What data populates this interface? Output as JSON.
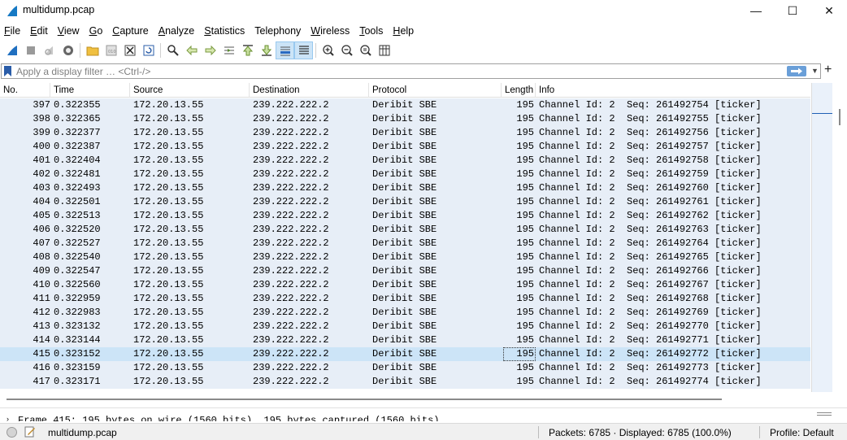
{
  "window": {
    "title": "multidump.pcap",
    "minimize": "—",
    "maximize": "☐",
    "close": "✕"
  },
  "menu": [
    {
      "label": "File",
      "u": "F",
      "rest": "ile"
    },
    {
      "label": "Edit",
      "u": "E",
      "rest": "dit"
    },
    {
      "label": "View",
      "u": "V",
      "rest": "iew"
    },
    {
      "label": "Go",
      "u": "G",
      "rest": "o"
    },
    {
      "label": "Capture",
      "u": "C",
      "rest": "apture"
    },
    {
      "label": "Analyze",
      "u": "A",
      "rest": "nalyze"
    },
    {
      "label": "Statistics",
      "u": "S",
      "rest": "tatistics"
    },
    {
      "label": "Telephony",
      "u": "",
      "rest": "Telephony"
    },
    {
      "label": "Wireless",
      "u": "W",
      "rest": "ireless"
    },
    {
      "label": "Tools",
      "u": "T",
      "rest": "ools"
    },
    {
      "label": "Help",
      "u": "H",
      "rest": "elp"
    }
  ],
  "toolbar": {
    "icons": [
      "shark-fin-start-icon",
      "stop-capture-icon",
      "restart-capture-icon",
      "capture-options-icon",
      "open-file-icon",
      "save-file-icon",
      "close-file-icon",
      "reload-file-icon",
      "find-packet-icon",
      "go-back-icon",
      "go-forward-icon",
      "go-to-packet-icon",
      "go-first-icon",
      "go-last-icon",
      "autoscroll-icon",
      "colorize-icon",
      "zoom-in-icon",
      "zoom-out-icon",
      "zoom-normal-icon",
      "resize-columns-icon"
    ],
    "active": [
      "autoscroll-icon"
    ]
  },
  "filter": {
    "placeholder": "Apply a display filter … <Ctrl-/>",
    "value": ""
  },
  "columns": [
    "No.",
    "Time",
    "Source",
    "Destination",
    "Protocol",
    "Length",
    "Info"
  ],
  "packets": [
    {
      "no": "397",
      "time": "0.322355",
      "src": "172.20.13.55",
      "dst": "239.222.222.2",
      "proto": "Deribit SBE",
      "len": "195",
      "info": "Channel Id: 2  Seq: 261492754 [ticker]"
    },
    {
      "no": "398",
      "time": "0.322365",
      "src": "172.20.13.55",
      "dst": "239.222.222.2",
      "proto": "Deribit SBE",
      "len": "195",
      "info": "Channel Id: 2  Seq: 261492755 [ticker]"
    },
    {
      "no": "399",
      "time": "0.322377",
      "src": "172.20.13.55",
      "dst": "239.222.222.2",
      "proto": "Deribit SBE",
      "len": "195",
      "info": "Channel Id: 2  Seq: 261492756 [ticker]"
    },
    {
      "no": "400",
      "time": "0.322387",
      "src": "172.20.13.55",
      "dst": "239.222.222.2",
      "proto": "Deribit SBE",
      "len": "195",
      "info": "Channel Id: 2  Seq: 261492757 [ticker]"
    },
    {
      "no": "401",
      "time": "0.322404",
      "src": "172.20.13.55",
      "dst": "239.222.222.2",
      "proto": "Deribit SBE",
      "len": "195",
      "info": "Channel Id: 2  Seq: 261492758 [ticker]"
    },
    {
      "no": "402",
      "time": "0.322481",
      "src": "172.20.13.55",
      "dst": "239.222.222.2",
      "proto": "Deribit SBE",
      "len": "195",
      "info": "Channel Id: 2  Seq: 261492759 [ticker]"
    },
    {
      "no": "403",
      "time": "0.322493",
      "src": "172.20.13.55",
      "dst": "239.222.222.2",
      "proto": "Deribit SBE",
      "len": "195",
      "info": "Channel Id: 2  Seq: 261492760 [ticker]"
    },
    {
      "no": "404",
      "time": "0.322501",
      "src": "172.20.13.55",
      "dst": "239.222.222.2",
      "proto": "Deribit SBE",
      "len": "195",
      "info": "Channel Id: 2  Seq: 261492761 [ticker]"
    },
    {
      "no": "405",
      "time": "0.322513",
      "src": "172.20.13.55",
      "dst": "239.222.222.2",
      "proto": "Deribit SBE",
      "len": "195",
      "info": "Channel Id: 2  Seq: 261492762 [ticker]"
    },
    {
      "no": "406",
      "time": "0.322520",
      "src": "172.20.13.55",
      "dst": "239.222.222.2",
      "proto": "Deribit SBE",
      "len": "195",
      "info": "Channel Id: 2  Seq: 261492763 [ticker]"
    },
    {
      "no": "407",
      "time": "0.322527",
      "src": "172.20.13.55",
      "dst": "239.222.222.2",
      "proto": "Deribit SBE",
      "len": "195",
      "info": "Channel Id: 2  Seq: 261492764 [ticker]"
    },
    {
      "no": "408",
      "time": "0.322540",
      "src": "172.20.13.55",
      "dst": "239.222.222.2",
      "proto": "Deribit SBE",
      "len": "195",
      "info": "Channel Id: 2  Seq: 261492765 [ticker]"
    },
    {
      "no": "409",
      "time": "0.322547",
      "src": "172.20.13.55",
      "dst": "239.222.222.2",
      "proto": "Deribit SBE",
      "len": "195",
      "info": "Channel Id: 2  Seq: 261492766 [ticker]"
    },
    {
      "no": "410",
      "time": "0.322560",
      "src": "172.20.13.55",
      "dst": "239.222.222.2",
      "proto": "Deribit SBE",
      "len": "195",
      "info": "Channel Id: 2  Seq: 261492767 [ticker]"
    },
    {
      "no": "411",
      "time": "0.322959",
      "src": "172.20.13.55",
      "dst": "239.222.222.2",
      "proto": "Deribit SBE",
      "len": "195",
      "info": "Channel Id: 2  Seq: 261492768 [ticker]"
    },
    {
      "no": "412",
      "time": "0.322983",
      "src": "172.20.13.55",
      "dst": "239.222.222.2",
      "proto": "Deribit SBE",
      "len": "195",
      "info": "Channel Id: 2  Seq: 261492769 [ticker]"
    },
    {
      "no": "413",
      "time": "0.323132",
      "src": "172.20.13.55",
      "dst": "239.222.222.2",
      "proto": "Deribit SBE",
      "len": "195",
      "info": "Channel Id: 2  Seq: 261492770 [ticker]"
    },
    {
      "no": "414",
      "time": "0.323144",
      "src": "172.20.13.55",
      "dst": "239.222.222.2",
      "proto": "Deribit SBE",
      "len": "195",
      "info": "Channel Id: 2  Seq: 261492771 [ticker]"
    },
    {
      "no": "415",
      "time": "0.323152",
      "src": "172.20.13.55",
      "dst": "239.222.222.2",
      "proto": "Deribit SBE",
      "len": "195",
      "info": "Channel Id: 2  Seq: 261492772 [ticker]",
      "selected": true
    },
    {
      "no": "416",
      "time": "0.323159",
      "src": "172.20.13.55",
      "dst": "239.222.222.2",
      "proto": "Deribit SBE",
      "len": "195",
      "info": "Channel Id: 2  Seq: 261492773 [ticker]"
    },
    {
      "no": "417",
      "time": "0.323171",
      "src": "172.20.13.55",
      "dst": "239.222.222.2",
      "proto": "Deribit SBE",
      "len": "195",
      "info": "Channel Id: 2  Seq: 261492774 [ticker]"
    }
  ],
  "details": {
    "line": "Frame 415: 195 bytes on wire (1560 bits), 195 bytes captured (1560 bits)"
  },
  "status": {
    "file": "multidump.pcap",
    "packets": "Packets: 6785 · Displayed: 6785 (100.0%)",
    "profile": "Profile: Default"
  },
  "colors": {
    "row_bg": "#e7eef7",
    "selected_bg": "#cce4f7",
    "accent": "#1f5fb4"
  }
}
